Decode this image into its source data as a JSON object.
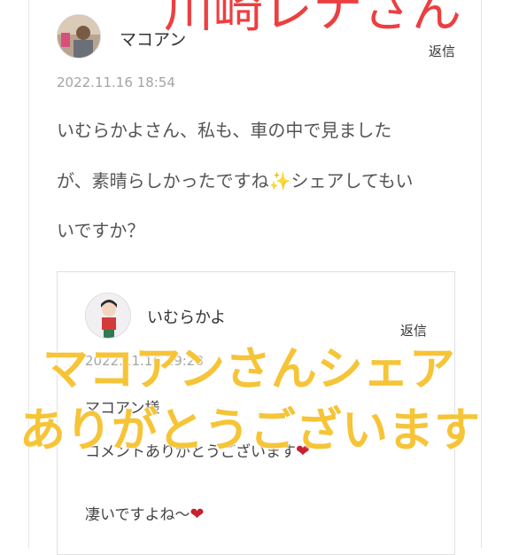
{
  "overlay": {
    "top_caption": "川崎レナさん",
    "caption_line1": "マコアンさんシェア",
    "caption_line2": "ありがとうございます",
    "caption_color": "#f6c437",
    "top_caption_color": "#ec3f41"
  },
  "comment": {
    "author": "マコアン",
    "reply_label": "返信",
    "date": "2022.11.16 18:54",
    "lines": [
      "いむらかよさん、私も、車の中で見ました",
      "が、素晴らしかったですね",
      "シェアしてもい",
      "いですか？"
    ],
    "emoji": "sparkles-icon"
  },
  "reply": {
    "author": "いむらかよ",
    "reply_label": "返信",
    "date": "2022.11.16 19:28",
    "lines": [
      "マコアン様",
      "コメントありがとうございます",
      "凄いですよね〜"
    ],
    "emoji": "red-heart-icon"
  }
}
